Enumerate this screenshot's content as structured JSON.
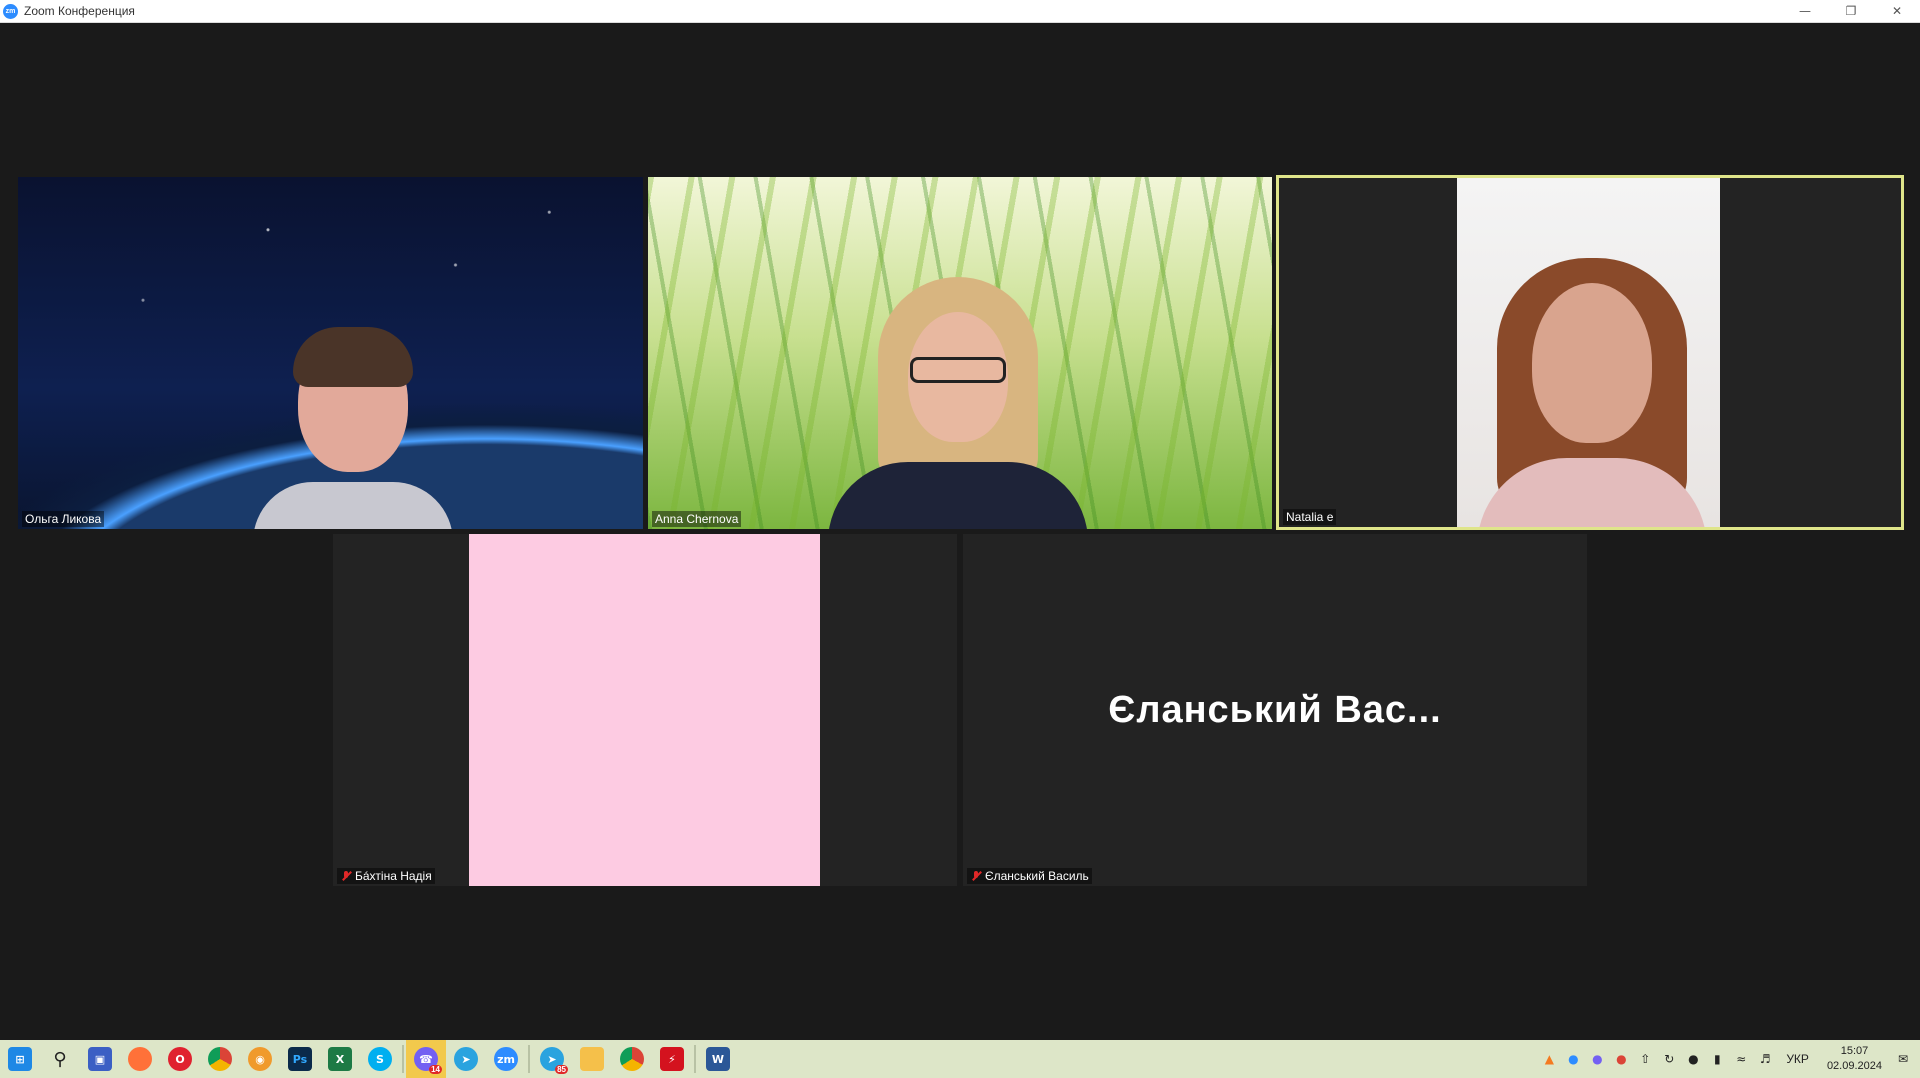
{
  "window": {
    "title": "Zoom Конференция",
    "app_icon_text": "zm",
    "minimize_icon": "minimize-icon",
    "restore_icon": "restore-icon",
    "close_icon": "close-icon"
  },
  "participants": [
    {
      "name": "Ольга Ликова",
      "muted": false,
      "video": true
    },
    {
      "name": "Anna Chernova",
      "muted": false,
      "video": true
    },
    {
      "name": "Natalia e",
      "muted": false,
      "video": true,
      "active_speaker": true
    },
    {
      "name": "Бáхтіна Надія",
      "muted": true,
      "video": true
    },
    {
      "name": "Єланський Василь",
      "muted": true,
      "video": false,
      "display_name_large": "Єланський  Вас..."
    }
  ],
  "colors": {
    "stage_bg": "#1a1a1a",
    "tile_bg": "#232323",
    "active_speaker_border": "#dfe58a",
    "taskbar_bg": "#dde6c8",
    "muted_red": "#e02828"
  },
  "taskbar": {
    "icons": [
      {
        "name": "windows-start-icon"
      },
      {
        "name": "search-icon"
      },
      {
        "name": "save-app-icon"
      },
      {
        "name": "firefox-icon"
      },
      {
        "name": "opera-icon"
      },
      {
        "name": "chrome-icon"
      },
      {
        "name": "eye-app-icon"
      },
      {
        "name": "photoshop-icon",
        "text": "Ps"
      },
      {
        "name": "excel-icon",
        "text": "X"
      },
      {
        "name": "skype-icon",
        "text": "S"
      },
      {
        "name": "viber-icon",
        "badge": "14",
        "active": true
      },
      {
        "name": "telegram-icon"
      },
      {
        "name": "zoom-icon",
        "text": "zm"
      },
      {
        "name": "telegram-2-icon",
        "badge": "85"
      },
      {
        "name": "file-explorer-icon"
      },
      {
        "name": "chrome-2-icon"
      },
      {
        "name": "acrobat-icon"
      },
      {
        "name": "word-icon",
        "text": "W"
      }
    ],
    "tray": {
      "language": "УКР",
      "time": "15:07",
      "date": "02.09.2024",
      "notification_count": "1"
    }
  }
}
